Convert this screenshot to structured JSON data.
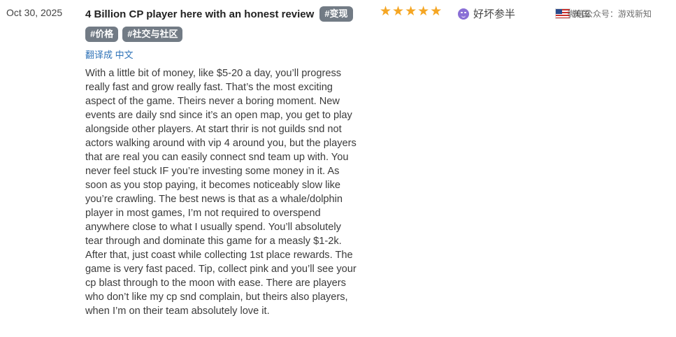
{
  "review": {
    "date": "Oct 30, 2025",
    "title": "4 Billion CP player here with an honest review",
    "tags": [
      "#变现",
      "#价格",
      "#社交与社区"
    ],
    "translate_link": "翻译成 中文",
    "body": "With a little bit of money, like $5-20 a day, you’ll progress really fast and grow really fast. That’s the most exciting aspect of the game. Theirs never a boring moment. New events are daily snd since it’s an open map, you get to play alongside other players. At start thrir is not guilds snd not actors walking around with vip 4 around you, but the players that are real you can easily connect snd team up with. You never feel stuck IF you’re investing some money in it. As soon as you stop paying, it becomes noticeably slow like you’re crawling. The best news is that as a whale/dolphin player in most games, I’m not required to overspend anywhere close to what I usually spend. You’ll absolutely tear through and dominate this game for a measly $1-2k. After that, just coast while collecting 1st place rewards. The game is very fast paced. Tip, collect pink and you’ll see your cp blast through to the moon with ease. There are players who don’t like my cp snd complain, but theirs also players, when I’m on their team absolutely love it.",
    "rating": 5,
    "star_glyph": "★",
    "sentiment": "好坏参半",
    "country": "美国",
    "watermark": "微信公众号：游戏新知"
  },
  "colors": {
    "tag_bg": "#727b85",
    "star": "#f5a623",
    "link": "#2f73b8",
    "sentiment_icon": "#8a6fd6"
  }
}
